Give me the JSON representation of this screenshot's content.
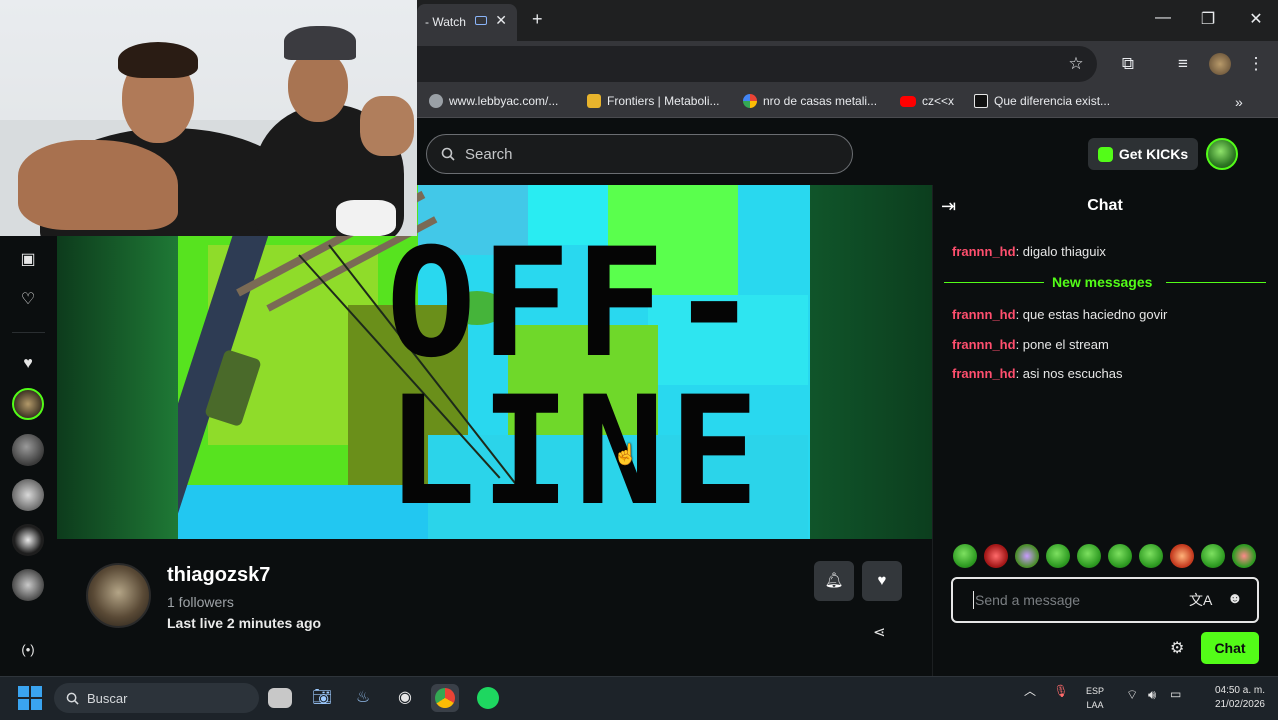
{
  "browser": {
    "tab_title": "- Watch",
    "bookmarks": [
      {
        "label": "www.lebbyac.com/...",
        "icon": "globe-icon",
        "color": "#9aa0a6"
      },
      {
        "label": "Frontiers | Metaboli...",
        "icon": "frontiers-icon",
        "color": "#e8b42c"
      },
      {
        "label": "nro de casas metali...",
        "icon": "google-icon",
        "color": "#4285f4"
      },
      {
        "label": "cz<<x",
        "icon": "youtube-icon",
        "color": "#ff0000"
      },
      {
        "label": "Que diferencia exist...",
        "icon": "bookmark-b-icon",
        "color": "#e6e6e6"
      }
    ]
  },
  "header": {
    "search_placeholder": "Search",
    "get_kicks_label": "Get KICKs"
  },
  "player": {
    "offline_line1": "OFF-",
    "offline_line2": "LINE"
  },
  "channel": {
    "name": "thiagozsk7",
    "followers": "1 followers",
    "last_live": "Last live 2 minutes ago"
  },
  "chat": {
    "title": "Chat",
    "messages": [
      {
        "user": "frannn_hd",
        "text": ": digalo thiaguix"
      },
      {
        "user": "frannn_hd",
        "text": ": que estas haciedno govir"
      },
      {
        "user": "frannn_hd",
        "text": ": pone el stream"
      },
      {
        "user": "frannn_hd",
        "text": ": asi nos escuchas"
      }
    ],
    "new_messages_label": "New messages",
    "input_placeholder": "Send a message",
    "send_label": "Chat"
  },
  "taskbar": {
    "search_label": "Buscar",
    "lang_line1": "ESP",
    "lang_line2": "LAA",
    "time": "04:50 a. m.",
    "date": "21/02/2026"
  },
  "colors": {
    "accent": "#53fc18",
    "username": "#ff4f6e"
  }
}
